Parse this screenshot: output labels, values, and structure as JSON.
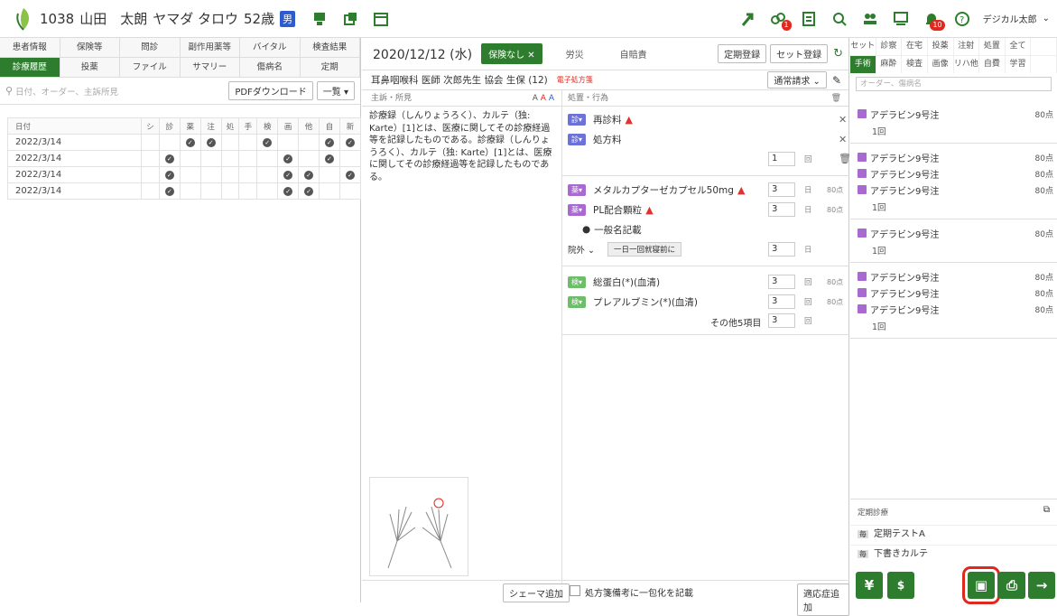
{
  "header": {
    "patient_id": "1038",
    "patient_name": "山田　太朗",
    "patient_kana": "ヤマダ タロウ",
    "age": "52歳",
    "sex_badge": "男",
    "notif_badge_1": "1",
    "notif_badge_2": "10",
    "user_name": "デジカル太郎"
  },
  "left": {
    "tabs_row1": [
      "患者情報",
      "保険等",
      "問診",
      "副作用薬等",
      "バイタル",
      "検査結果"
    ],
    "tabs_row2": [
      "診療履歴",
      "投薬",
      "ファイル",
      "サマリー",
      "傷病名",
      "定期"
    ],
    "search_placeholder": "日付、オーダー、主訴所見",
    "pdf_button": "PDFダウンロード",
    "list_select": "一覧",
    "table_headers": [
      "日付",
      "シ",
      "診",
      "薬",
      "注",
      "処",
      "手",
      "検",
      "画",
      "他",
      "自",
      "新"
    ],
    "rows": [
      {
        "date": "2022/3/14",
        "checks": [
          0,
          0,
          1,
          1,
          0,
          0,
          1,
          0,
          0,
          1,
          1
        ]
      },
      {
        "date": "2022/3/14",
        "checks": [
          0,
          1,
          0,
          0,
          0,
          0,
          0,
          1,
          0,
          1,
          0
        ]
      },
      {
        "date": "2022/3/14",
        "checks": [
          0,
          1,
          0,
          0,
          0,
          0,
          0,
          1,
          1,
          0,
          1
        ]
      },
      {
        "date": "2022/3/14",
        "checks": [
          0,
          1,
          0,
          0,
          0,
          0,
          0,
          1,
          1,
          0,
          0
        ]
      }
    ]
  },
  "center": {
    "date": "2020/12/12 (水)",
    "insurance_tab": "保険なし ✕",
    "tab_rousai": "労災",
    "tab_jibai": "自賠責",
    "btn_teiki": "定期登録",
    "btn_set": "セット登録",
    "dept_line": "耳鼻咽喉科 医師 次郎先生 協会 生保 (12)",
    "e_presc": "電子処方箋",
    "billing_select": "通常請求",
    "notes_header": "主訴・所見",
    "orders_header": "処置・行為",
    "note_text": "診療録（しんりょうろく）、カルテ（独: Karte）[1]とは、医療に関してその診療経過等を記録したものである。診療録（しんりょうろく）、カルテ（独: Karte）[1]とは、医療に関してその診療経過等を記録したものである。",
    "schema_button": "シェーマ追加",
    "checkbox_label": "処方箋備考に一包化を記載",
    "adapt_button": "適応症追加",
    "orders": {
      "tag_shin": "診",
      "tag_yaku": "薬",
      "tag_ken": "検",
      "o1": "再診料",
      "o2": "処方料",
      "o2_qty": "1",
      "o2_unit": "回",
      "m1": "メタルカプターゼカプセル50mg",
      "m1_qty": "3",
      "m1_unit": "日",
      "m1_pts": "80点",
      "m2": "PL配合顆粒",
      "m2_qty": "3",
      "m2_unit": "日",
      "m2_pts": "80点",
      "generic": "一般名記載",
      "inout": "院外",
      "timing": "一日一回就寝前に",
      "timing_qty": "3",
      "timing_unit": "日",
      "k1": "総蛋白(*)(血清)",
      "k1_qty": "3",
      "k1_unit": "回",
      "k1_pts": "80点",
      "k2": "プレアルブミン(*)(血清)",
      "k2_qty": "3",
      "k2_unit": "回",
      "k2_pts": "80点",
      "other": "その他5項目",
      "other_qty": "3",
      "other_unit": "回"
    }
  },
  "right": {
    "tabs_row1": [
      "セット",
      "診察",
      "在宅",
      "投薬",
      "注射",
      "処置",
      "全て"
    ],
    "tabs_row2": [
      "手術",
      "麻酔",
      "検査",
      "画像",
      "リハ他",
      "自費",
      "学習"
    ],
    "search_placeholder": "オーダー、傷病名",
    "item_name": "アデラビン9号注",
    "item_pts": "80点",
    "sub_label": "1回",
    "teiki_title": "定期診療",
    "teiki_1": "定期テストA",
    "teiki_2": "下書きカルテ",
    "teiki_prefix": "毎"
  }
}
